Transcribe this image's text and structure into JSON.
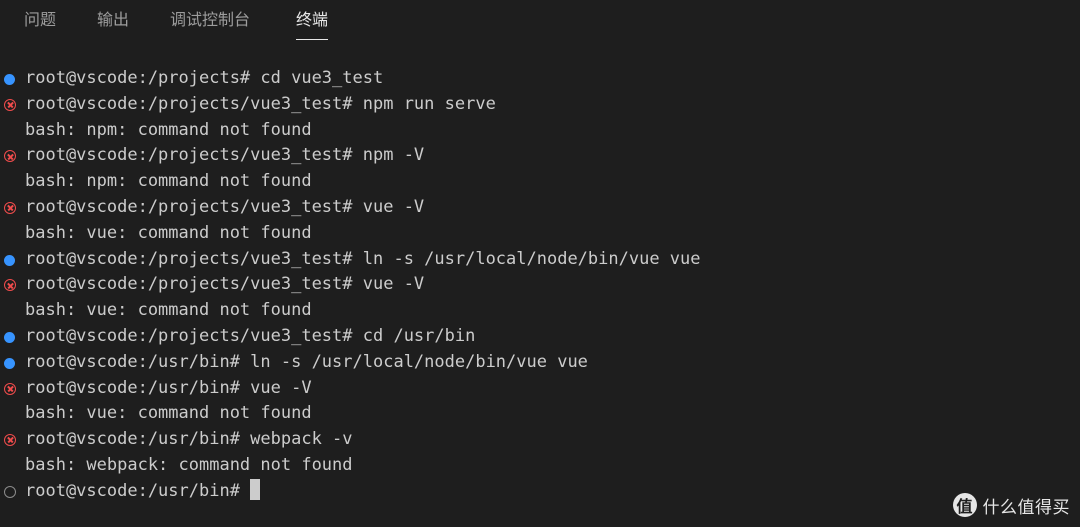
{
  "tabs": [
    {
      "label": "问题",
      "active": false
    },
    {
      "label": "输出",
      "active": false
    },
    {
      "label": "调试控制台",
      "active": false
    },
    {
      "label": "终端",
      "active": true
    }
  ],
  "terminal": {
    "lines": [
      {
        "status": "ok",
        "text": "root@vscode:/projects# cd vue3_test"
      },
      {
        "status": "err",
        "text": "root@vscode:/projects/vue3_test# npm run serve"
      },
      {
        "status": "none",
        "text": "bash: npm: command not found"
      },
      {
        "status": "err",
        "text": "root@vscode:/projects/vue3_test# npm -V"
      },
      {
        "status": "none",
        "text": "bash: npm: command not found"
      },
      {
        "status": "err",
        "text": "root@vscode:/projects/vue3_test# vue -V"
      },
      {
        "status": "none",
        "text": "bash: vue: command not found"
      },
      {
        "status": "ok",
        "text": "root@vscode:/projects/vue3_test# ln -s /usr/local/node/bin/vue vue"
      },
      {
        "status": "err",
        "text": "root@vscode:/projects/vue3_test# vue -V"
      },
      {
        "status": "none",
        "text": "bash: vue: command not found"
      },
      {
        "status": "ok",
        "text": "root@vscode:/projects/vue3_test# cd /usr/bin"
      },
      {
        "status": "ok",
        "text": "root@vscode:/usr/bin# ln -s /usr/local/node/bin/vue vue"
      },
      {
        "status": "err",
        "text": "root@vscode:/usr/bin# vue -V"
      },
      {
        "status": "none",
        "text": "bash: vue: command not found"
      },
      {
        "status": "err",
        "text": "root@vscode:/usr/bin# webpack -v"
      },
      {
        "status": "none",
        "text": "bash: webpack: command not found"
      },
      {
        "status": "pending",
        "text": "root@vscode:/usr/bin#",
        "cursor": true
      }
    ]
  },
  "icons": {
    "ok": "circle-filled-icon",
    "err": "circle-x-icon",
    "pending": "circle-outline-icon"
  },
  "colors": {
    "background": "#1e1e1e",
    "text": "#cccccc",
    "ok": "#3794ff",
    "err": "#f14c4c",
    "pending": "#8c8c8c"
  },
  "watermark": {
    "logo": "值",
    "text": "什么值得买"
  }
}
